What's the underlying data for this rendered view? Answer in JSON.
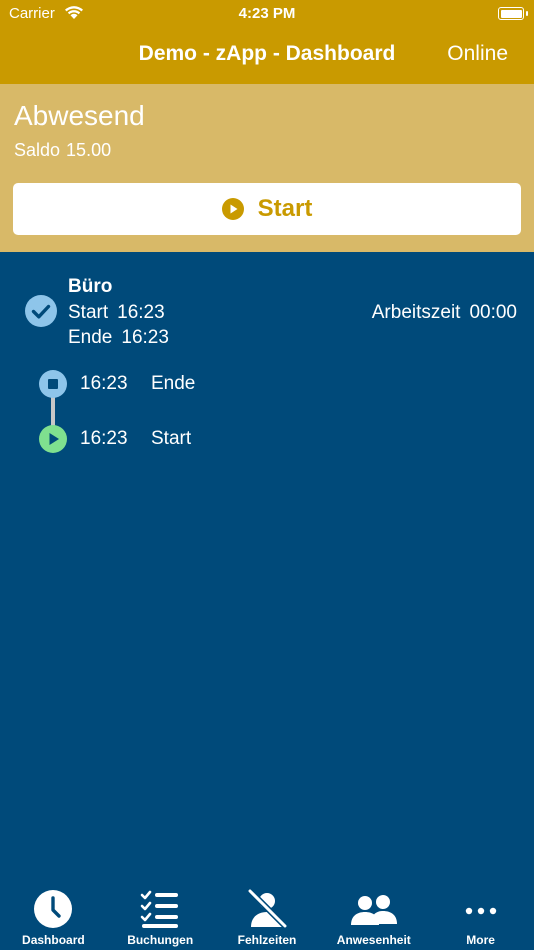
{
  "status_bar": {
    "carrier": "Carrier",
    "time": "4:23 PM"
  },
  "nav": {
    "title": "Demo - zApp - Dashboard",
    "connection_status": "Online"
  },
  "status_panel": {
    "state": "Abwesend",
    "saldo_label": "Saldo",
    "saldo_value": "15.00",
    "start_button_label": "Start"
  },
  "entry": {
    "title": "Büro",
    "start_label": "Start",
    "start_time": "16:23",
    "end_label": "Ende",
    "end_time": "16:23",
    "worktime_label": "Arbeitszeit",
    "worktime_value": "00:00"
  },
  "timeline": [
    {
      "time": "16:23",
      "label": "Ende",
      "icon": "stop-icon"
    },
    {
      "time": "16:23",
      "label": "Start",
      "icon": "play-icon"
    }
  ],
  "tabs": [
    {
      "label": "Dashboard",
      "icon": "clock-icon",
      "active": true
    },
    {
      "label": "Buchungen",
      "icon": "checklist-icon"
    },
    {
      "label": "Fehlzeiten",
      "icon": "person-crossed-icon"
    },
    {
      "label": "Anwesenheit",
      "icon": "people-icon"
    },
    {
      "label": "More",
      "icon": "more-dots-icon"
    }
  ],
  "colors": {
    "nav_bar": "#c99a00",
    "status_panel": "#d8b968",
    "main_background": "#004a7a",
    "check_icon": "#8ec5ea",
    "play_icon": "#7fe08f",
    "stop_icon": "#8ec5ea"
  }
}
